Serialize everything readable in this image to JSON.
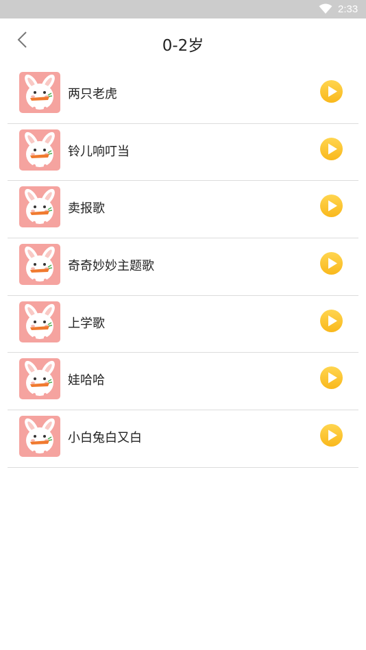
{
  "status_bar": {
    "time": "2:33"
  },
  "header": {
    "title": "0-2岁"
  },
  "songs": [
    {
      "title": "两只老虎"
    },
    {
      "title": "铃儿响叮当"
    },
    {
      "title": "卖报歌"
    },
    {
      "title": "奇奇妙妙主题歌"
    },
    {
      "title": "上学歌"
    },
    {
      "title": "娃哈哈"
    },
    {
      "title": "小白兔白又白"
    }
  ],
  "colors": {
    "status_bar": "#cccccc",
    "thumb_bg": "#f5a39f",
    "play_button": "#fbc02d",
    "divider": "#dcdcdc"
  },
  "icons": {
    "back": "back-arrow-icon",
    "thumb": "bunny-carrot-icon",
    "play": "play-circle-icon",
    "wifi": "wifi-icon"
  }
}
